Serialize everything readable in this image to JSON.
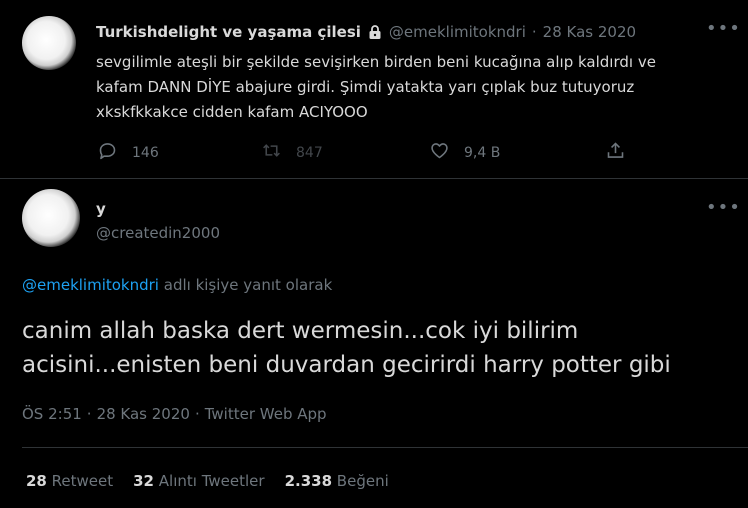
{
  "first_tweet": {
    "display_name": "Turkishdelight ve yaşama çilesi",
    "handle": "@emeklimitokndri",
    "separator": "·",
    "date": "28 Kas 2020",
    "text_lines": [
      "sevgilimle ateşli bir şekilde sevişirken birden beni kucağına alıp kaldırdı ve",
      "kafam DANN DİYE abajure girdi. Şimdi yatakta yarı çıplak buz tutuyoruz",
      "xkskfkkakce cidden kafam ACIYOOO"
    ],
    "reply_count": "146",
    "retweet_count": "847",
    "like_count": "9,4 B"
  },
  "reply_tweet": {
    "display_name": "y",
    "handle": "@createdin2000",
    "replying_to_handle": "@emeklimitokndri",
    "replying_to_suffix": "adlı kişiye yanıt olarak",
    "text_lines": [
      "canim allah baska dert wermesin...cok iyi bilirim",
      "acisini...enisten beni duvardan gecirirdi harry potter gibi"
    ],
    "time": "ÖS 2:51",
    "date": "28 Kas 2020",
    "source": "Twitter Web App",
    "meta_separator": "·"
  },
  "stats": {
    "retweets_count": "28",
    "retweets_label": "Retweet",
    "quotes_count": "32",
    "quotes_label": "Alıntı Tweetler",
    "likes_count": "2.338",
    "likes_label": "Beğeni"
  },
  "colors": {
    "background": "#000000",
    "text": "#d9d9d9",
    "muted": "#6e767d",
    "link": "#1da1f2",
    "divider": "#2f3336"
  },
  "icons": [
    "lock-icon",
    "more-icon",
    "reply-icon",
    "retweet-icon",
    "like-icon",
    "share-icon"
  ]
}
